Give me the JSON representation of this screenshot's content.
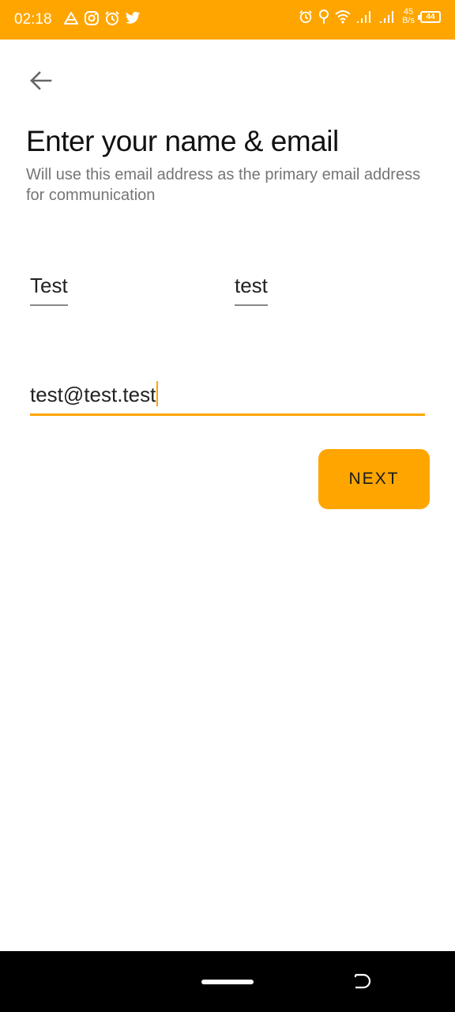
{
  "status_bar": {
    "time": "02:18",
    "left_icons": [
      "drive-icon",
      "instagram-icon",
      "alarm-icon",
      "twitter-icon"
    ],
    "right_icons": [
      "alarm-icon",
      "location-icon",
      "wifi-icon",
      "signal-icon",
      "signal-icon"
    ],
    "net_speed_value": "45",
    "net_speed_unit": "B/s",
    "battery": "44",
    "background": "#FFA500"
  },
  "header": {
    "back_icon": "arrow-left-icon",
    "title": "Enter your name & email",
    "subtitle": "Will use this email address as the primary email address for communication"
  },
  "form": {
    "first_name": "Test",
    "last_name": "test",
    "email": "test@test.test",
    "focused_field": "email"
  },
  "actions": {
    "next_label": "NEXT"
  },
  "colors": {
    "accent": "#FFA500",
    "title": "#111111",
    "subtitle": "#757575"
  }
}
